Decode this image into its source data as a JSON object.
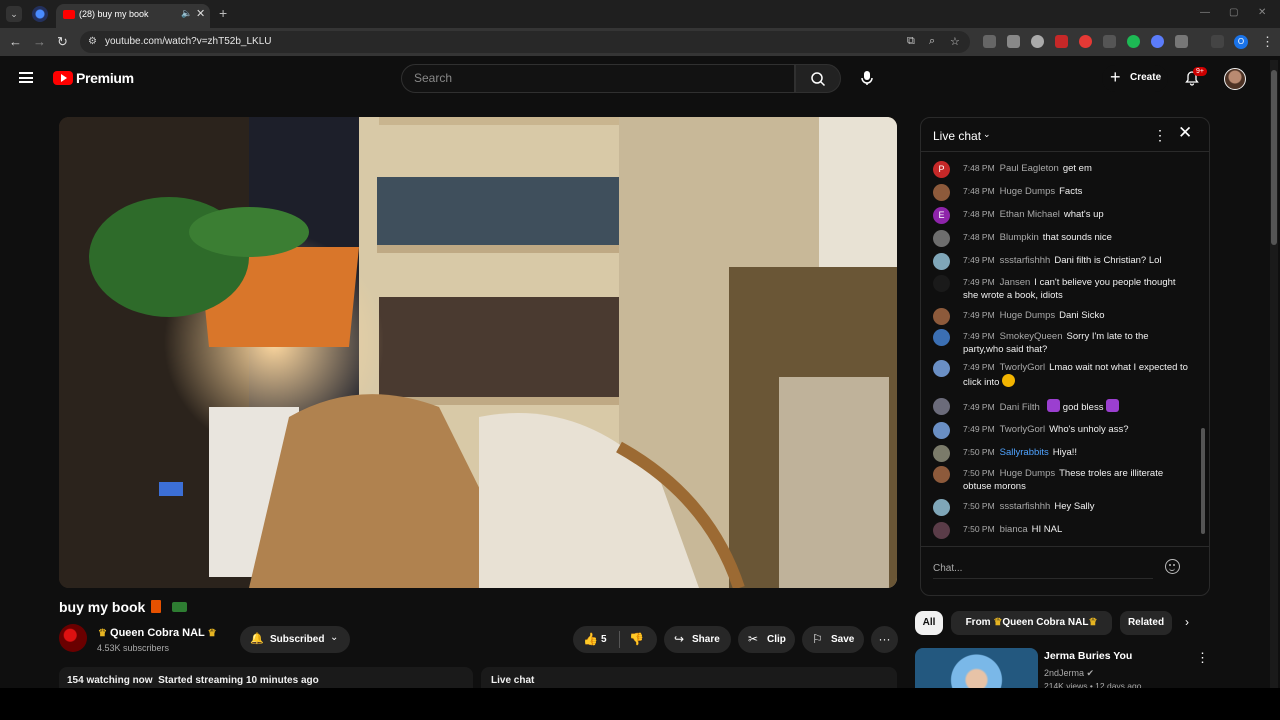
{
  "browser": {
    "tab_title": "(28) buy my book",
    "url": "youtube.com/watch?v=zhT52b_LKLU",
    "new_tab_symbol": "+",
    "tab_close_symbol": "✕",
    "profile_initial": "O"
  },
  "header": {
    "brand": "Premium",
    "search_placeholder": "Search",
    "create_label": "Create",
    "notification_count": "9+"
  },
  "video": {
    "title": "buy my book",
    "channel_name": "Queen Cobra NAL",
    "subscribers": "4.53K subscribers",
    "subscribed_label": "Subscribed",
    "like_count": "5",
    "share_label": "Share",
    "clip_label": "Clip",
    "save_label": "Save",
    "more_symbol": "···",
    "watching": "154 watching now",
    "started": "Started streaming 10 minutes ago",
    "live_chat_bar": "Live chat"
  },
  "chat": {
    "title": "Live chat",
    "input_placeholder": "Chat...",
    "messages": [
      {
        "time": "7:48 PM",
        "author": "Paul Eagleton",
        "text": "get em",
        "avatar_letter": "P",
        "avatar_color": "#c62828"
      },
      {
        "time": "7:48 PM",
        "author": "Huge Dumps",
        "text": "Facts",
        "avatar_letter": "",
        "avatar_color": "#8d5a3b"
      },
      {
        "time": "7:48 PM",
        "author": "Ethan Michael",
        "text": "what's up",
        "avatar_letter": "E",
        "avatar_color": "#8e24aa"
      },
      {
        "time": "7:48 PM",
        "author": "Blumpkin",
        "text": "that sounds nice",
        "avatar_letter": "",
        "avatar_color": "#6d6d6d"
      },
      {
        "time": "7:49 PM",
        "author": "ssstarfishhh",
        "text": "Dani filth is Christian? Lol",
        "avatar_letter": "",
        "avatar_color": "#7fa6b8"
      },
      {
        "time": "7:49 PM",
        "author": "Jansen",
        "text": "I can't believe you people thought she wrote a book, idiots",
        "avatar_letter": "",
        "avatar_color": "#1a1a1a"
      },
      {
        "time": "7:49 PM",
        "author": "Huge Dumps",
        "text": "Dani Sicko",
        "avatar_letter": "",
        "avatar_color": "#8d5a3b"
      },
      {
        "time": "7:49 PM",
        "author": "SmokeyQueen",
        "text": "Sorry I'm late to the party,who said that?",
        "avatar_letter": "",
        "avatar_color": "#3b6fb3"
      },
      {
        "time": "7:49 PM",
        "author": "TworlyGorl",
        "text": "Lmao wait not what I expected to click into",
        "avatar_letter": "",
        "avatar_color": "#6a8fc4"
      },
      {
        "time": "7:49 PM",
        "author": "Dani Filth",
        "text": "god bless",
        "avatar_letter": "",
        "avatar_color": "#6b6b7a"
      },
      {
        "time": "7:49 PM",
        "author": "TworlyGorl",
        "text": "Who's unholy ass?",
        "avatar_letter": "",
        "avatar_color": "#6a8fc4"
      },
      {
        "time": "7:50 PM",
        "author": "Sallyrabbits",
        "text": "Hiya!!",
        "avatar_letter": "",
        "avatar_color": "#7b7b6a"
      },
      {
        "time": "7:50 PM",
        "author": "Huge Dumps",
        "text": "These troles are illiterate obtuse morons",
        "avatar_letter": "",
        "avatar_color": "#8d5a3b"
      },
      {
        "time": "7:50 PM",
        "author": "ssstarfishhh",
        "text": "Hey Sally",
        "avatar_letter": "",
        "avatar_color": "#7fa6b8"
      },
      {
        "time": "7:50 PM",
        "author": "bianca",
        "text": "HI NAL",
        "avatar_letter": "",
        "avatar_color": "#5a3c48"
      }
    ]
  },
  "chips": {
    "all": "All",
    "from_prefix": "From",
    "from_channel": "Queen Cobra NAL",
    "related": "Related"
  },
  "recommendation": {
    "title": "Jerma Buries You",
    "channel": "2ndJerma",
    "meta": "214K views • 12 days ago"
  },
  "colors": {
    "brand_red": "#ff0000",
    "bg": "#0f0f0f",
    "link_blue": "#4fa3ff"
  }
}
